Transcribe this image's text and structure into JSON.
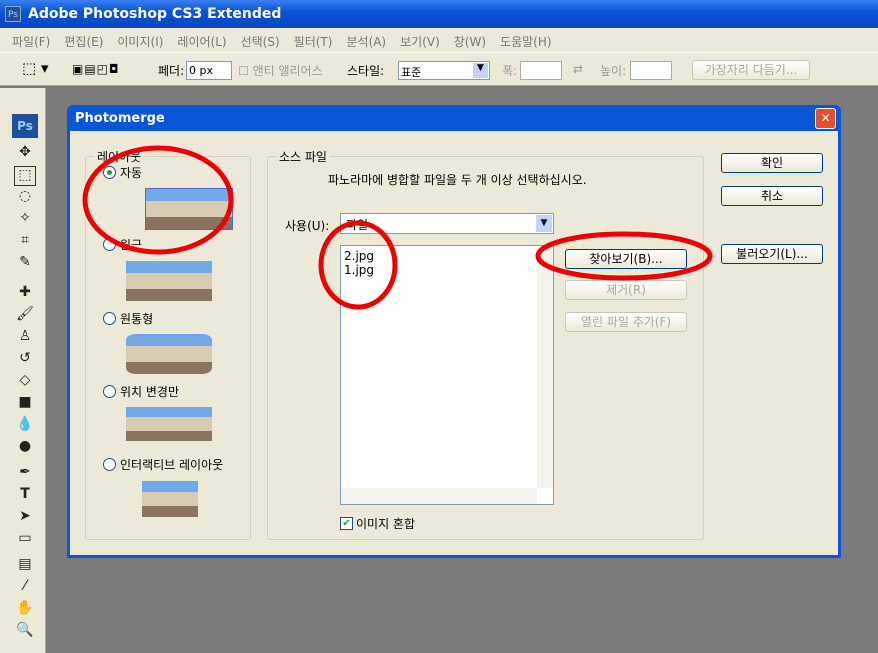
{
  "app": {
    "title": "Adobe Photoshop CS3 Extended",
    "icon": "Ps"
  },
  "menu": [
    "파일(F)",
    "편집(E)",
    "이미지(I)",
    "레이어(L)",
    "선택(S)",
    "필터(T)",
    "분석(A)",
    "보기(V)",
    "창(W)",
    "도움말(H)"
  ],
  "options": {
    "feather_label": "페더:",
    "feather_value": "0 px",
    "antialias_label": "앤티 앨리어스",
    "style_label": "스타일:",
    "style_value": "표준",
    "width_label": "폭:",
    "height_label": "높이:",
    "refine_button": "가장자리 다듬기..."
  },
  "toolbox": {
    "logo": "Ps"
  },
  "dialog": {
    "title": "Photomerge",
    "layout": {
      "legend": "레이아웃",
      "options": [
        {
          "label": "자동",
          "selected": true
        },
        {
          "label": "원근",
          "selected": false
        },
        {
          "label": "원통형",
          "selected": false
        },
        {
          "label": "위치 변경만",
          "selected": false
        },
        {
          "label": "인터랙티브 레이아웃",
          "selected": false
        }
      ]
    },
    "source": {
      "legend": "소스 파일",
      "instruction": "파노라마에 병합할 파일을 두 개 이상 선택하십시오.",
      "use_label": "사용(U):",
      "use_value": "파일",
      "files": [
        "2.jpg",
        "1.jpg"
      ],
      "browse": "찾아보기(B)...",
      "remove": "제거(R)",
      "add_open": "열린 파일 추가(F)",
      "blend_label": "이미지 혼합",
      "blend_checked": true
    },
    "ok": "확인",
    "cancel": "취소",
    "load": "불러오기(L)..."
  }
}
